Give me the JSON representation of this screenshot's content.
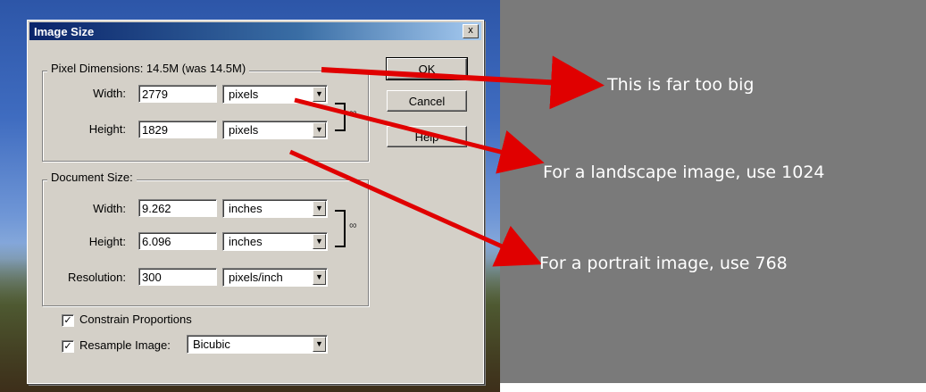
{
  "dialog": {
    "title": "Image Size",
    "close_glyph": "x",
    "pixel_dimensions": {
      "label": "Pixel Dimensions:  14.5M (was 14.5M)",
      "width_label": "Width:",
      "width_value": "2779",
      "width_unit": "pixels",
      "height_label": "Height:",
      "height_value": "1829",
      "height_unit": "pixels"
    },
    "document_size": {
      "label": "Document Size:",
      "width_label": "Width:",
      "width_value": "9.262",
      "width_unit": "inches",
      "height_label": "Height:",
      "height_value": "6.096",
      "height_unit": "inches",
      "resolution_label": "Resolution:",
      "resolution_value": "300",
      "resolution_unit": "pixels/inch"
    },
    "buttons": {
      "ok": "OK",
      "cancel": "Cancel",
      "help": "Help"
    },
    "constrain": {
      "label": "Constrain Proportions",
      "checked": true
    },
    "resample": {
      "label": "Resample Image:",
      "checked": true,
      "method": "Bicubic"
    }
  },
  "annotations": {
    "too_big": "This is far too big",
    "landscape": "For a landscape image, use 1024",
    "portrait": "For a portrait image, use  768"
  },
  "colors": {
    "arrow": "#e00000",
    "annotation_text": "#ffffff",
    "background_gray": "#7a7a7a"
  }
}
